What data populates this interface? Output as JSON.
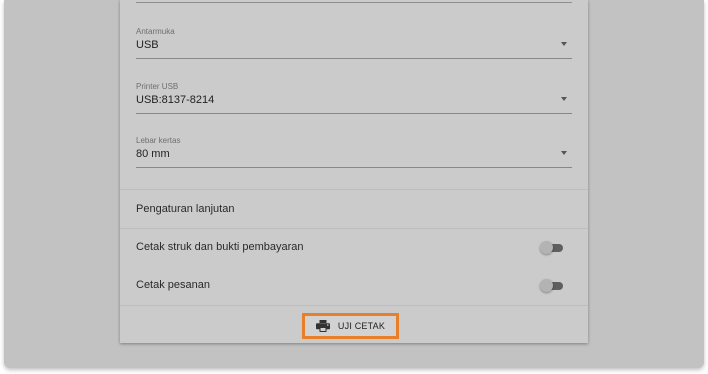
{
  "fields": [
    {
      "label": "Antarmuka",
      "value": "USB"
    },
    {
      "label": "Printer USB",
      "value": "USB:8137-8214"
    },
    {
      "label": "Lebar kertas",
      "value": "80 mm"
    }
  ],
  "advanced_settings": {
    "label": "Pengaturan lanjutan"
  },
  "toggles": [
    {
      "label": "Cetak struk dan bukti pembayaran",
      "on": false
    },
    {
      "label": "Cetak pesanan",
      "on": false
    }
  ],
  "test_print": {
    "label": "UJI CETAK",
    "icon": "printer-icon"
  },
  "colors": {
    "highlight": "#e8802a",
    "backdrop": "#c2c2c2",
    "panel": "#cbcbcb"
  }
}
